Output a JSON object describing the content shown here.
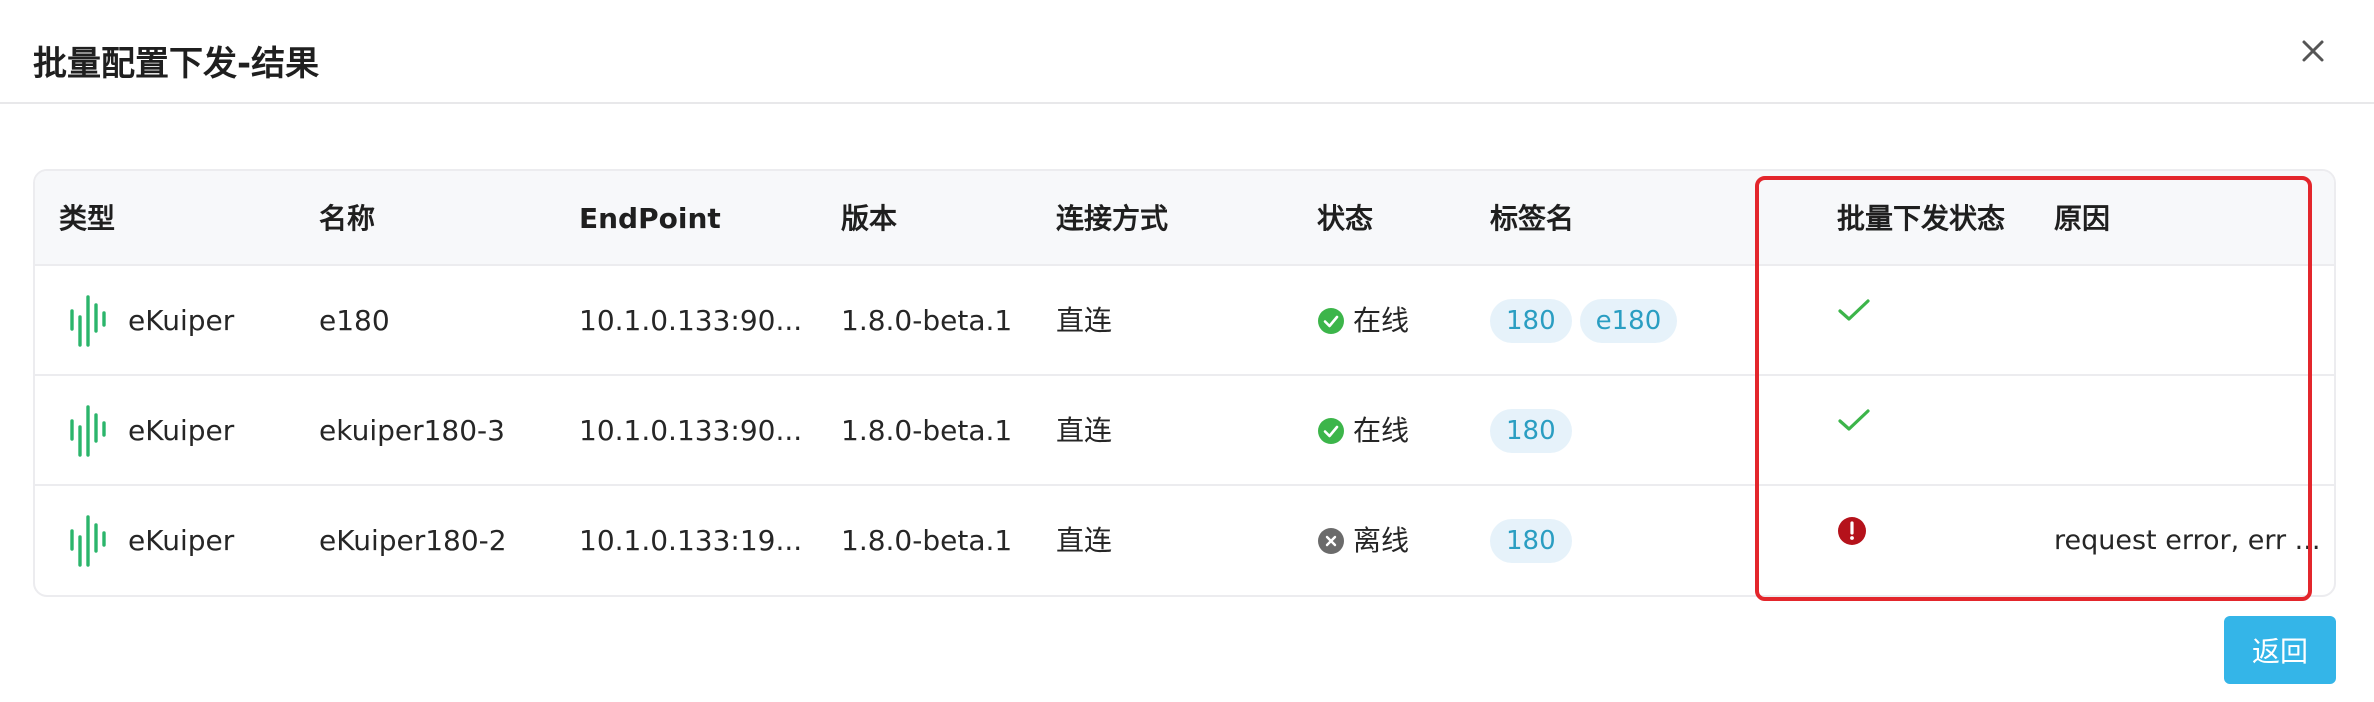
{
  "modal": {
    "title": "批量配置下发-结果",
    "close_icon": "close-icon",
    "back_label": "返回"
  },
  "table": {
    "columns": [
      "类型",
      "名称",
      "EndPoint",
      "版本",
      "连接方式",
      "状态",
      "标签名",
      "批量下发状态",
      "原因"
    ],
    "rows": [
      {
        "type": "eKuiper",
        "type_icon": "ekuiper-logo-icon",
        "name": "e180",
        "endpoint": "10.1.0.133:90...",
        "version": "1.8.0-beta.1",
        "connection": "直连",
        "status": "在线",
        "status_icon": "online-check-icon",
        "tags": [
          "180",
          "e180"
        ],
        "result_icon": "success-check-icon",
        "reason": ""
      },
      {
        "type": "eKuiper",
        "type_icon": "ekuiper-logo-icon",
        "name": "ekuiper180-3",
        "endpoint": "10.1.0.133:90...",
        "version": "1.8.0-beta.1",
        "connection": "直连",
        "status": "在线",
        "status_icon": "online-check-icon",
        "tags": [
          "180"
        ],
        "result_icon": "success-check-icon",
        "reason": ""
      },
      {
        "type": "eKuiper",
        "type_icon": "ekuiper-logo-icon",
        "name": "eKuiper180-2",
        "endpoint": "10.1.0.133:19...",
        "version": "1.8.0-beta.1",
        "connection": "直连",
        "status": "离线",
        "status_icon": "offline-x-icon",
        "tags": [
          "180"
        ],
        "result_icon": "error-exclamation-icon",
        "reason": "request error, err ..."
      }
    ]
  },
  "colors": {
    "accent": "#34b5e8",
    "online": "#3cb54a",
    "offline": "#6b6b6b",
    "error": "#b5121b",
    "tag_bg": "#e6f2fa",
    "tag_text": "#2a9ec2",
    "highlight": "#e3262c"
  }
}
